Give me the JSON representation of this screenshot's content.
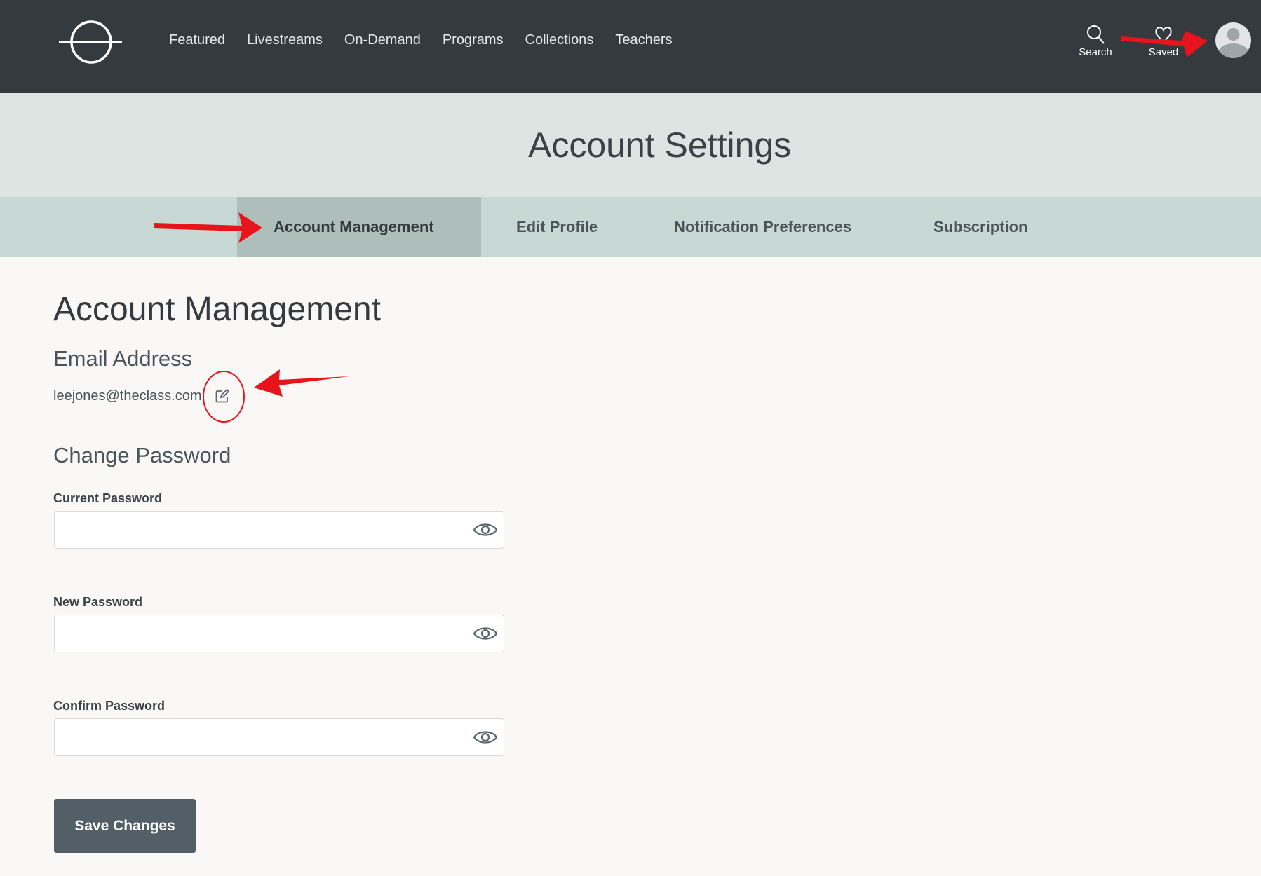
{
  "header": {
    "nav": [
      "Featured",
      "Livestreams",
      "On-Demand",
      "Programs",
      "Collections",
      "Teachers"
    ],
    "search_label": "Search",
    "saved_label": "Saved"
  },
  "hero": {
    "title": "Account Settings"
  },
  "tabs": [
    {
      "label": "Account Management",
      "active": true
    },
    {
      "label": "Edit Profile",
      "active": false
    },
    {
      "label": "Notification Preferences",
      "active": false
    },
    {
      "label": "Subscription",
      "active": false
    }
  ],
  "main": {
    "title": "Account Management",
    "email_heading": "Email Address",
    "email": "leejones@theclass.com",
    "password_heading": "Change Password",
    "fields": [
      {
        "label": "Current Password",
        "value": ""
      },
      {
        "label": "New Password",
        "value": ""
      },
      {
        "label": "Confirm Password",
        "value": ""
      }
    ],
    "save_label": "Save Changes"
  },
  "colors": {
    "header_bg": "#343a3e",
    "hero_bg": "#dce5e2",
    "tabs_bg": "#c8d8d5",
    "active_tab_bg": "#aebfbb",
    "button_bg": "#525f66",
    "annotation": "#e8141b"
  }
}
